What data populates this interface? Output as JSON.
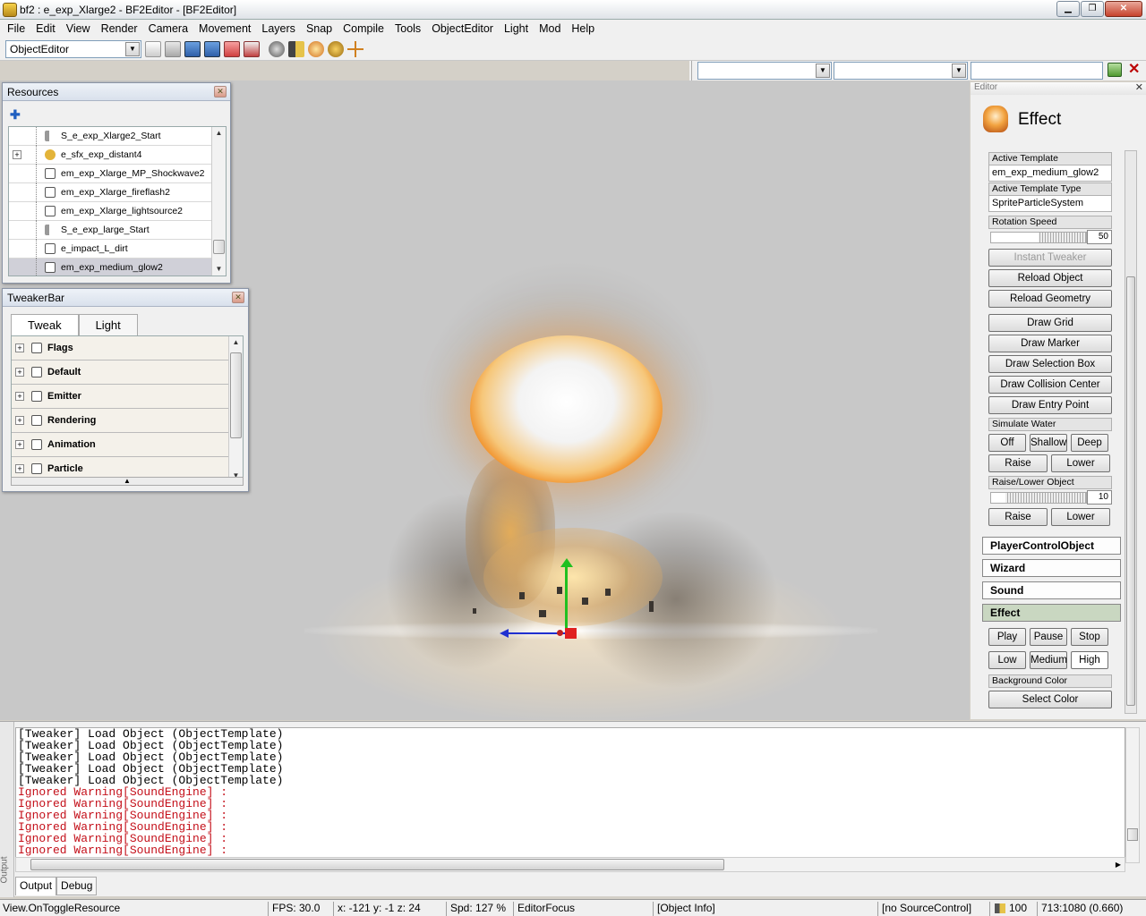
{
  "window": {
    "title": "bf2 : e_exp_Xlarge2 - BF2Editor - [BF2Editor]",
    "controls": [
      "minimize",
      "maximize",
      "close"
    ]
  },
  "menubar": [
    "File",
    "Edit",
    "View",
    "Render",
    "Camera",
    "Movement",
    "Layers",
    "Snap",
    "Compile",
    "Tools",
    "ObjectEditor",
    "Light",
    "Mod",
    "Help"
  ],
  "toolbar": {
    "editor_combo": "ObjectEditor",
    "icons": [
      "new-icon",
      "open-icon",
      "save-icon",
      "save-all-icon",
      "import-icon",
      "export-icon",
      "settings-icon",
      "sound-icon",
      "effect-icon",
      "tweak-icon",
      "pivot-icon"
    ]
  },
  "resources": {
    "title": "Resources",
    "items": [
      {
        "label": "S_e_exp_Xlarge2_Start",
        "icon": "sound-icon",
        "expandable": false,
        "selected": false
      },
      {
        "label": "e_sfx_exp_distant4",
        "icon": "effect-bundle-icon",
        "expandable": true,
        "selected": false
      },
      {
        "label": "em_exp_Xlarge_MP_Shockwave2",
        "icon": "emitter-icon",
        "expandable": false,
        "selected": false
      },
      {
        "label": "em_exp_Xlarge_fireflash2",
        "icon": "emitter-icon",
        "expandable": false,
        "selected": false
      },
      {
        "label": "em_exp_Xlarge_lightsource2",
        "icon": "emitter-icon",
        "expandable": false,
        "selected": false
      },
      {
        "label": "S_e_exp_large_Start",
        "icon": "sound-icon",
        "expandable": false,
        "selected": false
      },
      {
        "label": "e_impact_L_dirt",
        "icon": "emitter-icon",
        "expandable": false,
        "selected": false
      },
      {
        "label": "em_exp_medium_glow2",
        "icon": "emitter-icon",
        "expandable": false,
        "selected": true
      }
    ]
  },
  "tweakerbar": {
    "title": "TweakerBar",
    "tabs": [
      "Tweak",
      "Light"
    ],
    "active_tab": "Tweak",
    "groups": [
      "Flags",
      "Default",
      "Emitter",
      "Rendering",
      "Animation",
      "Particle"
    ]
  },
  "editor": {
    "title": "Editor",
    "header": "Effect",
    "active_template_label": "Active Template",
    "active_template_value": "em_exp_medium_glow2",
    "active_template_type_label": "Active Template Type",
    "active_template_type_value": "SpriteParticleSystem",
    "rotation_speed_label": "Rotation Speed",
    "rotation_speed_value": "50",
    "rotation_speed_level": 0.5,
    "buttons": {
      "instant_tweaker": "Instant Tweaker",
      "reload_object": "Reload Object",
      "reload_geometry": "Reload Geometry",
      "draw_grid": "Draw Grid",
      "draw_marker": "Draw Marker",
      "draw_selection_box": "Draw Selection Box",
      "draw_collision_center": "Draw Collision Center",
      "draw_entry_point": "Draw Entry Point"
    },
    "simulate_water_label": "Simulate Water",
    "water_buttons": [
      "Off",
      "Shallow",
      "Deep"
    ],
    "water_raise": "Raise",
    "water_lower": "Lower",
    "raise_lower_label": "Raise/Lower Object",
    "raise_lower_value": "10",
    "raise_lower_level": 0.15,
    "object_raise": "Raise",
    "object_lower": "Lower",
    "sections": [
      "PlayerControlObject",
      "Wizard",
      "Sound",
      "Effect"
    ],
    "effect_controls": [
      "Play",
      "Pause",
      "Stop"
    ],
    "effect_quality": [
      "Low",
      "Medium",
      "High"
    ],
    "effect_quality_selected": "High",
    "background_color_label": "Background Color",
    "select_color": "Select Color"
  },
  "output": {
    "side_label": "Output",
    "lines": [
      {
        "text": "[Tweaker] Load Object (ObjectTemplate)",
        "type": "info"
      },
      {
        "text": "[Tweaker] Load Object (ObjectTemplate)",
        "type": "info"
      },
      {
        "text": "[Tweaker] Load Object (ObjectTemplate)",
        "type": "info"
      },
      {
        "text": "[Tweaker] Load Object (ObjectTemplate)",
        "type": "info"
      },
      {
        "text": "[Tweaker] Load Object (ObjectTemplate)",
        "type": "info"
      },
      {
        "text": "Ignored Warning[SoundEngine] :",
        "type": "warn"
      },
      {
        "text": "Ignored Warning[SoundEngine] :",
        "type": "warn"
      },
      {
        "text": "Ignored Warning[SoundEngine] :",
        "type": "warn"
      },
      {
        "text": "Ignored Warning[SoundEngine] :",
        "type": "warn"
      },
      {
        "text": "Ignored Warning[SoundEngine] :",
        "type": "warn"
      },
      {
        "text": "Ignored Warning[SoundEngine] :",
        "type": "warn"
      }
    ],
    "tabs": [
      "Output",
      "Debug"
    ],
    "active_tab": "Output"
  },
  "statusbar": {
    "action": "View.OnToggleResource",
    "fps": "FPS: 30.0",
    "coords": "x: -121 y: -1 z: 24",
    "speed": "Spd: 127 %",
    "focus": "EditorFocus",
    "object_info": "[Object Info]",
    "source_control": "[no SourceControl]",
    "volume": "100",
    "resolution": "713:1080 (0.660)"
  },
  "colors": {
    "warning_text": "#c4101a",
    "viewport_bg": "#c8c8c8",
    "active_section": "#c9d7c1"
  }
}
